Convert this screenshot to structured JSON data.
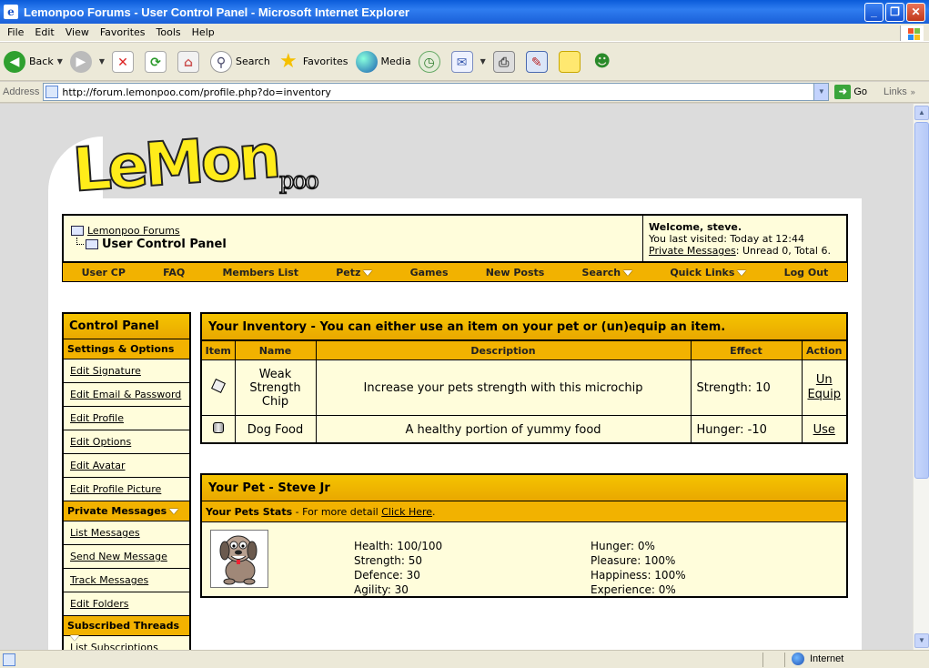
{
  "window": {
    "title": "Lemonpoo Forums - User Control Panel - Microsoft Internet Explorer"
  },
  "menubar": [
    "File",
    "Edit",
    "View",
    "Favorites",
    "Tools",
    "Help"
  ],
  "toolbar": {
    "back": "Back",
    "search": "Search",
    "favorites": "Favorites",
    "media": "Media"
  },
  "address": {
    "label": "Address",
    "url": "http://forum.lemonpoo.com/profile.php?do=inventory",
    "go": "Go",
    "links": "Links"
  },
  "logo": {
    "big": "LeMon",
    "small": "poo"
  },
  "breadcrumb": {
    "forum": "Lemonpoo Forums",
    "current": "User Control Panel"
  },
  "welcome": {
    "greeting": "Welcome, steve.",
    "last_visit": "You last visited: Today at 12:44",
    "pm_link": "Private Messages",
    "pm_counts": ": Unread 0, Total 6."
  },
  "nav": [
    {
      "label": "User CP",
      "dropdown": false
    },
    {
      "label": "FAQ",
      "dropdown": false
    },
    {
      "label": "Members List",
      "dropdown": false
    },
    {
      "label": "Petz",
      "dropdown": true
    },
    {
      "label": "Games",
      "dropdown": false
    },
    {
      "label": "New Posts",
      "dropdown": false
    },
    {
      "label": "Search",
      "dropdown": true
    },
    {
      "label": "Quick Links",
      "dropdown": true
    },
    {
      "label": "Log Out",
      "dropdown": false
    }
  ],
  "sidebar": {
    "title": "Control Panel",
    "sections": [
      {
        "title": "Settings & Options",
        "dropdown": false,
        "items": [
          "Edit Signature",
          "Edit Email & Password",
          "Edit Profile",
          "Edit Options",
          "Edit Avatar",
          "Edit Profile Picture"
        ]
      },
      {
        "title": "Private Messages",
        "dropdown": true,
        "items": [
          "List Messages",
          "Send New Message",
          "Track Messages",
          "Edit Folders"
        ]
      },
      {
        "title": "Subscribed Threads",
        "dropdown": true,
        "items": [
          "List Subscriptions"
        ]
      }
    ]
  },
  "inventory": {
    "title": "Your Inventory - You can either use an item on your pet or (un)equip an item.",
    "headers": {
      "item": "Item",
      "name": "Name",
      "description": "Description",
      "effect": "Effect",
      "action": "Action"
    },
    "rows": [
      {
        "icon": "microchip-icon",
        "name": "Weak Strength Chip",
        "description": "Increase your pets strength with this microchip",
        "effect": "Strength: 10",
        "action": "Un Equip"
      },
      {
        "icon": "dog-food-can-icon",
        "name": "Dog Food",
        "description": "A healthy portion of yummy food",
        "effect": "Hunger: -10",
        "action": "Use"
      }
    ]
  },
  "pet": {
    "title": "Your Pet - Steve Jr",
    "stats_label": "Your Pets Stats",
    "stats_hint": " - For more detail ",
    "stats_link": "Click Here",
    "stats_end": ".",
    "left": [
      "Health: 100/100",
      "Strength: 50",
      "Defence: 30",
      "Agility: 30"
    ],
    "right": [
      "Hunger: 0%",
      "Pleasure: 100%",
      "Happiness: 100%",
      "Experience: 0%"
    ]
  },
  "status": {
    "zone": "Internet"
  },
  "colors": {
    "accent": "#f2b200",
    "panel_bg": "#fffddb",
    "title_blue": "#0a5bd9"
  }
}
